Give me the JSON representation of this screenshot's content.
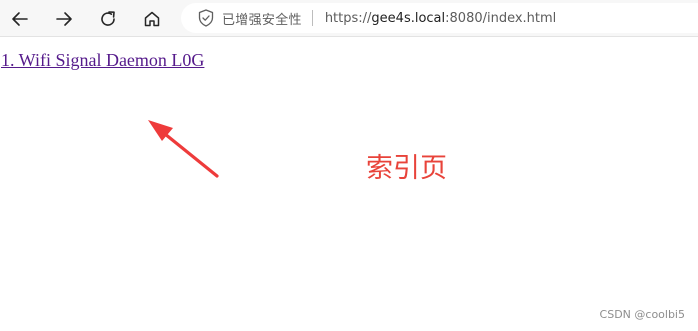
{
  "browser": {
    "nav": [
      {
        "name": "back-icon",
        "interactable": true
      },
      {
        "name": "forward-icon",
        "interactable": true
      },
      {
        "name": "reload-icon",
        "interactable": true
      },
      {
        "name": "home-icon",
        "interactable": true
      }
    ],
    "address": {
      "security_icon": "shield-icon",
      "security_label": "已增强安全性",
      "url_prefix": "https://",
      "url_host": "gee4s.local",
      "url_rest": ":8080/index.html"
    }
  },
  "page": {
    "link_text": "1. Wifi Signal Daemon L0G"
  },
  "annotation": {
    "text": "索引页",
    "color": "#e8433a"
  },
  "watermark": {
    "text": "CSDN @coolbi5"
  },
  "colors": {
    "visited_link": "#551a8b",
    "toolbar_bg": "#f7f7f7"
  }
}
